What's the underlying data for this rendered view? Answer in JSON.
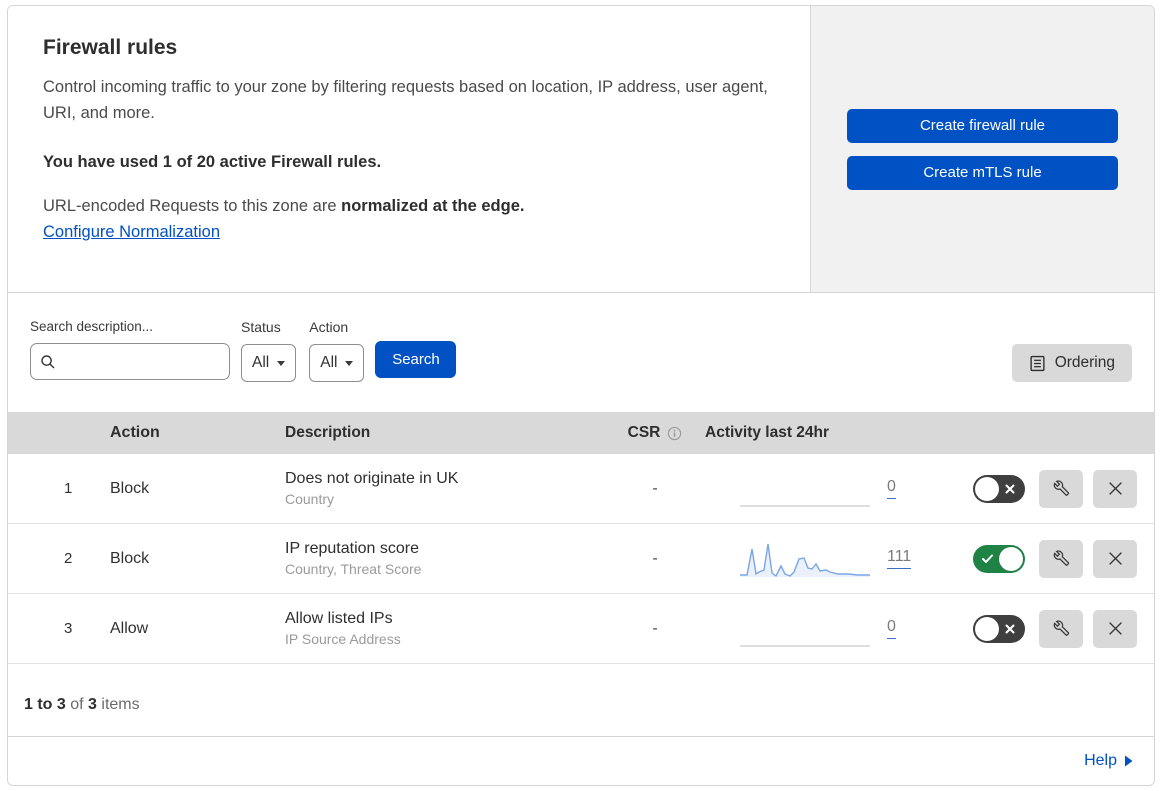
{
  "colors": {
    "primary_blue": "#0051c3",
    "link_blue": "#0051c3",
    "toggle_on_green": "#208346",
    "toggle_off_gray": "#3f3f3f",
    "sparkline": "#7aa5e6",
    "sparkline_fill": "rgba(122,165,230,0.16)",
    "flat_line": "#c9c9c9",
    "table_header_bg": "#d9d9d9",
    "side_panel_bg": "#f1f1f1"
  },
  "header": {
    "title": "Firewall rules",
    "description": "Control incoming traffic to your zone by filtering requests based on location, IP address, user agent, URI, and more.",
    "usage": "You have used 1 of 20 active Firewall rules.",
    "normalization_text": "URL-encoded Requests to this zone are",
    "normalization_bold": "normalized at the edge.",
    "normalization_link": "Configure Normalization",
    "create_firewall_button": "Create firewall rule",
    "create_mtls_button": "Create mTLS rule"
  },
  "filters": {
    "search_label": "Search description...",
    "search_value": "",
    "status_label": "Status",
    "status_value": "All",
    "action_label": "Action",
    "action_value": "All",
    "search_button": "Search",
    "ordering_button": "Ordering"
  },
  "table": {
    "columns": {
      "action": "Action",
      "description": "Description",
      "csr": "CSR",
      "activity": "Activity last 24hr"
    },
    "rows": [
      {
        "number": "1",
        "action": "Block",
        "description": "Does not originate in UK",
        "fields": "Country",
        "csr": "-",
        "count": "0",
        "enabled": false,
        "activity_points": null
      },
      {
        "number": "2",
        "action": "Block",
        "description": "IP reputation score",
        "fields": "Country, Threat Score",
        "csr": "-",
        "count": "111",
        "enabled": true,
        "activity_points": [
          [
            0,
            34
          ],
          [
            7,
            34
          ],
          [
            12,
            8
          ],
          [
            16,
            33
          ],
          [
            19,
            31
          ],
          [
            24,
            29
          ],
          [
            28,
            3
          ],
          [
            32,
            32
          ],
          [
            36,
            35
          ],
          [
            41,
            25
          ],
          [
            45,
            33
          ],
          [
            50,
            35
          ],
          [
            54,
            31
          ],
          [
            59,
            18
          ],
          [
            64,
            17
          ],
          [
            68,
            27
          ],
          [
            72,
            28
          ],
          [
            76,
            23
          ],
          [
            80,
            30
          ],
          [
            86,
            29
          ],
          [
            90,
            31
          ],
          [
            98,
            33
          ],
          [
            108,
            33
          ],
          [
            118,
            34
          ],
          [
            130,
            34
          ]
        ]
      },
      {
        "number": "3",
        "action": "Allow",
        "description": "Allow listed IPs",
        "fields": "IP Source Address",
        "csr": "-",
        "count": "0",
        "enabled": false,
        "activity_points": null
      }
    ]
  },
  "footer": {
    "range": "1 to 3",
    "of_label": "of",
    "total": "3",
    "items_label": "items"
  },
  "help": {
    "label": "Help"
  }
}
